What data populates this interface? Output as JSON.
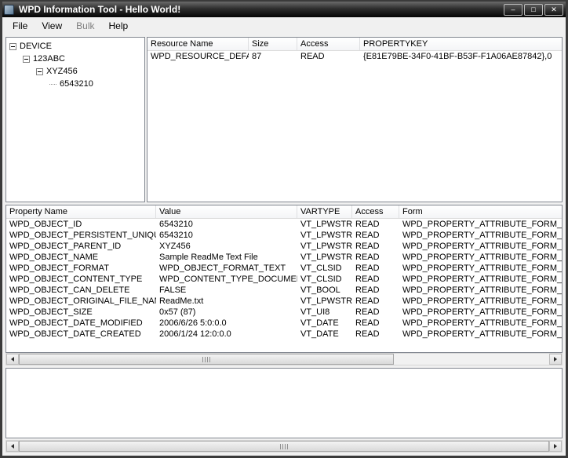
{
  "window": {
    "title": "WPD Information Tool - Hello World!",
    "controls": {
      "minimize_glyph": "–",
      "maximize_glyph": "□",
      "close_glyph": "✕"
    }
  },
  "menu": {
    "items": [
      {
        "label": "File",
        "enabled": true
      },
      {
        "label": "View",
        "enabled": true
      },
      {
        "label": "Bulk",
        "enabled": false
      },
      {
        "label": "Help",
        "enabled": true
      }
    ]
  },
  "tree": {
    "items": [
      {
        "label": "DEVICE",
        "level": 0,
        "expandable": true,
        "expanded": true
      },
      {
        "label": "123ABC",
        "level": 1,
        "expandable": true,
        "expanded": true
      },
      {
        "label": "XYZ456",
        "level": 2,
        "expandable": true,
        "expanded": true
      },
      {
        "label": "6543210",
        "level": 3,
        "expandable": false,
        "expanded": false
      }
    ]
  },
  "resource_list": {
    "columns": [
      "Resource Name",
      "Size",
      "Access",
      "PROPERTYKEY"
    ],
    "rows": [
      [
        "WPD_RESOURCE_DEFAULT",
        "87",
        "READ",
        "{E81E79BE-34F0-41BF-B53F-F1A06AE87842},0"
      ]
    ]
  },
  "property_table": {
    "columns": [
      "Property Name",
      "Value",
      "VARTYPE",
      "Access",
      "Form"
    ],
    "rows": [
      [
        "WPD_OBJECT_ID",
        "6543210",
        "VT_LPWSTR",
        "READ",
        "WPD_PROPERTY_ATTRIBUTE_FORM_UNSP"
      ],
      [
        "WPD_OBJECT_PERSISTENT_UNIQUE_ID",
        "6543210",
        "VT_LPWSTR",
        "READ",
        "WPD_PROPERTY_ATTRIBUTE_FORM_UNSP"
      ],
      [
        "WPD_OBJECT_PARENT_ID",
        "XYZ456",
        "VT_LPWSTR",
        "READ",
        "WPD_PROPERTY_ATTRIBUTE_FORM_UNSP"
      ],
      [
        "WPD_OBJECT_NAME",
        "Sample ReadMe Text File",
        "VT_LPWSTR",
        "READ",
        "WPD_PROPERTY_ATTRIBUTE_FORM_UNSP"
      ],
      [
        "WPD_OBJECT_FORMAT",
        "WPD_OBJECT_FORMAT_TEXT",
        "VT_CLSID",
        "READ",
        "WPD_PROPERTY_ATTRIBUTE_FORM_UNSP"
      ],
      [
        "WPD_OBJECT_CONTENT_TYPE",
        "WPD_CONTENT_TYPE_DOCUMENT",
        "VT_CLSID",
        "READ",
        "WPD_PROPERTY_ATTRIBUTE_FORM_UNSP"
      ],
      [
        "WPD_OBJECT_CAN_DELETE",
        "FALSE",
        "VT_BOOL",
        "READ",
        "WPD_PROPERTY_ATTRIBUTE_FORM_UNSP"
      ],
      [
        "WPD_OBJECT_ORIGINAL_FILE_NAME",
        "ReadMe.txt",
        "VT_LPWSTR",
        "READ",
        "WPD_PROPERTY_ATTRIBUTE_FORM_UNSP"
      ],
      [
        "WPD_OBJECT_SIZE",
        "0x57 (87)",
        "VT_UI8",
        "READ",
        "WPD_PROPERTY_ATTRIBUTE_FORM_UNSP"
      ],
      [
        "WPD_OBJECT_DATE_MODIFIED",
        "2006/6/26 5:0:0.0",
        "VT_DATE",
        "READ",
        "WPD_PROPERTY_ATTRIBUTE_FORM_UNSP"
      ],
      [
        "WPD_OBJECT_DATE_CREATED",
        "2006/1/24 12:0:0.0",
        "VT_DATE",
        "READ",
        "WPD_PROPERTY_ATTRIBUTE_FORM_UNSP"
      ]
    ]
  },
  "output": {
    "text": ""
  },
  "colors": {
    "frame-color": "#3a3a3a",
    "menubar-bg": "#f0f0f0",
    "panel-border": "#828790",
    "panel-bg": "#ffffff",
    "disabled-text": "#7f7f7f",
    "header-line": "#dedfe1"
  }
}
